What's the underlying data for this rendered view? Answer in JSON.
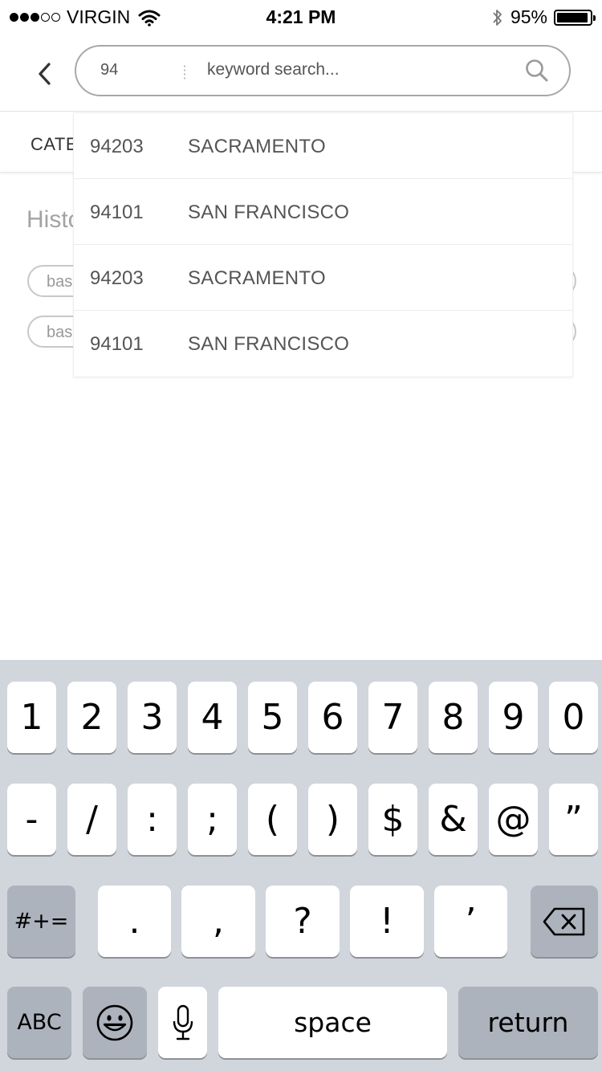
{
  "status_bar": {
    "carrier": "VIRGIN",
    "time": "4:21 PM",
    "battery_percent": "95%",
    "battery_level": 0.95,
    "signal_bars_filled": 3,
    "signal_bars_total": 5
  },
  "search": {
    "zip_value": "94",
    "keyword_placeholder": "keyword search..."
  },
  "category": {
    "label": "CATE"
  },
  "history": {
    "title": "Histo",
    "chips": [
      "bas",
      "bas"
    ]
  },
  "suggestions": [
    {
      "zip": "94203",
      "city": "SACRAMENTO"
    },
    {
      "zip": "94101",
      "city": "SAN FRANCISCO"
    },
    {
      "zip": "94203",
      "city": "SACRAMENTO"
    },
    {
      "zip": "94101",
      "city": "SAN FRANCISCO"
    }
  ],
  "keyboard": {
    "row1": [
      "1",
      "2",
      "3",
      "4",
      "5",
      "6",
      "7",
      "8",
      "9",
      "0"
    ],
    "row2": [
      "-",
      "/",
      ":",
      ";",
      "(",
      ")",
      "$",
      "&",
      "@",
      "”"
    ],
    "row3": [
      ".",
      ",",
      "?",
      "!",
      "’"
    ],
    "symbols_toggle": "#+=",
    "abc": "ABC",
    "space": "space",
    "return": "return"
  },
  "colors": {
    "keyboard_bg": "#d1d5dc",
    "dark_key": "#adb3bc",
    "search_border": "#a8a8a8"
  }
}
